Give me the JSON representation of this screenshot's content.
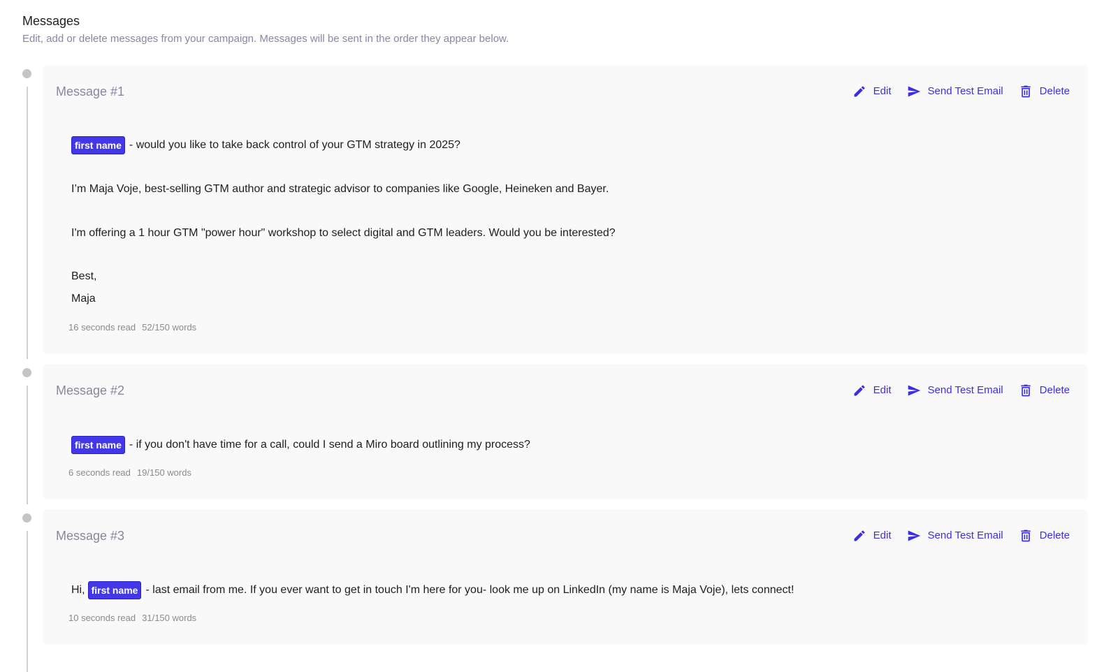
{
  "header": {
    "title": "Messages",
    "subtitle": "Edit, add or delete messages from your campaign. Messages will be sent in the order they appear below."
  },
  "actions": {
    "edit": "Edit",
    "send_test": "Send Test Email",
    "delete": "Delete"
  },
  "messages": [
    {
      "title": "Message #1",
      "chip": "first name",
      "line1_after": "- would you like to take back control of your GTM strategy in 2025?",
      "line2": "I’m Maja Voje, best-selling GTM author and strategic advisor to companies like Google, Heineken and Bayer.",
      "line3": "I'm offering a 1 hour GTM \"power hour\" workshop to select digital and GTM leaders. Would you be interested?",
      "line4": "Best,",
      "line5": "Maja",
      "read_time": "16 seconds read",
      "word_count": "52/150 words"
    },
    {
      "title": "Message #2",
      "chip": "first name",
      "line1_after": "- if you don't have time for a call, could I send a Miro board outlining my process?",
      "read_time": "6 seconds read",
      "word_count": "19/150 words"
    },
    {
      "title": "Message #3",
      "line1_before": "Hi,",
      "chip": "first name",
      "line1_after": "- last email from me. If you ever want to get in touch I'm here for you- look me up on LinkedIn (my name is Maja Voje), lets connect!",
      "read_time": "10 seconds read",
      "word_count": "31/150 words"
    }
  ],
  "colors": {
    "accent": "#3b2fe0",
    "chip_bg": "#4338e8",
    "card_bg": "#f9f9fa",
    "muted_text": "#8a86a0"
  }
}
